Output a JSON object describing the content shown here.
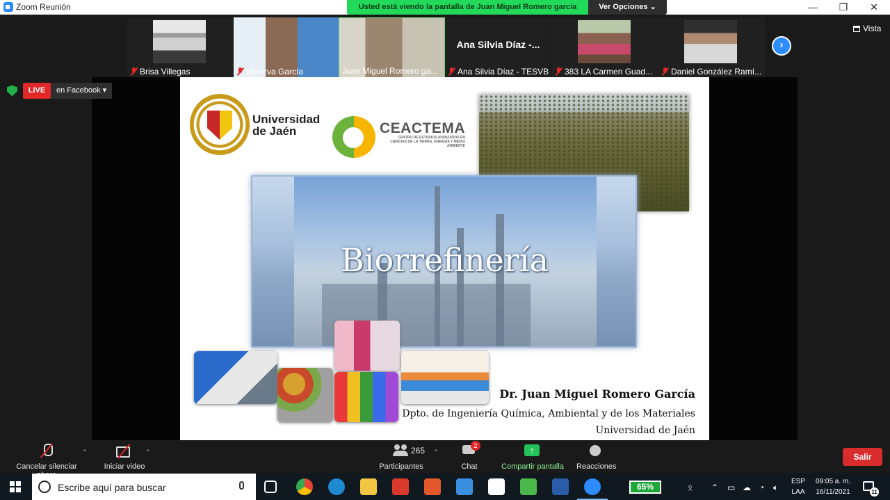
{
  "window": {
    "title": "Zoom Reunión",
    "controls": [
      "—",
      "❐",
      "✕"
    ]
  },
  "share_banner": {
    "text": "Usted está viendo la pantalla de Juan Miguel Romero garcía",
    "view_options": "Ver Opciones ⌄"
  },
  "gallery": {
    "participants": [
      {
        "name": "Brisa Villegas",
        "muted": true,
        "video": true,
        "colors": [
          "#e8e8e8",
          "#3a3a3a"
        ]
      },
      {
        "name": "Minerva García",
        "muted": true,
        "video": true,
        "colors": [
          "#4a86c8",
          "#222"
        ]
      },
      {
        "name": "Juan Miguel Romero ga...",
        "muted": false,
        "video": true,
        "active": true,
        "colors": [
          "#c8c2b2",
          "#6c5a45"
        ]
      },
      {
        "name": "Ana Silvia Díaz - TESVB",
        "display": "Ana Silvia Díaz -...",
        "muted": true,
        "video": false
      },
      {
        "name": "383 LA Carmen Guad...",
        "muted": true,
        "video": true,
        "colors": [
          "#b8c8a8",
          "#6a4a3a"
        ]
      },
      {
        "name": "Daniel González Ramí...",
        "muted": true,
        "video": true,
        "colors": [
          "#d8d8d8",
          "#303030"
        ]
      }
    ],
    "next_icon": "›",
    "view_label": "Vista"
  },
  "live": {
    "badge": "LIVE",
    "destination": "en Facebook ▾"
  },
  "slide": {
    "university": "Universidad\nde Jaén",
    "center_title": "CEACTEMA",
    "center_subtitle": "CENTRO DE ESTUDIOS AVANZADOS EN CIENCIAS DE LA TIERRA, ENERGÍA Y MEDIO AMBIENTE",
    "title": "Biorrefinería",
    "author": "Dr. Juan Miguel Romero García",
    "department": "Dpto. de Ingeniería Química, Ambiental y de los Materiales",
    "institution": "Universidad de Jaén"
  },
  "toolbar": {
    "mute": "Cancelar silenciar ahora",
    "video": "Iniciar video",
    "participants_count": "265",
    "participants": "Participantes",
    "chat": "Chat",
    "chat_badge": "2",
    "share": "Compartir pantalla",
    "reactions": "Reacciones",
    "leave": "Salir"
  },
  "taskbar": {
    "search_placeholder": "Escribe aquí para buscar",
    "battery": "65%",
    "lang_1": "ESP",
    "lang_2": "LAA",
    "time": "09:05 a. m.",
    "date": "16/11/2021",
    "notifications": "11",
    "apps": [
      {
        "name": "task-view",
        "color": "#ffffff"
      },
      {
        "name": "chrome",
        "color": "#e0a020"
      },
      {
        "name": "edge",
        "color": "#1f8ad2"
      },
      {
        "name": "file-explorer",
        "color": "#f4c542"
      },
      {
        "name": "app-red",
        "color": "#d93a2b"
      },
      {
        "name": "powerpoint-like",
        "color": "#e0582b"
      },
      {
        "name": "mail",
        "color": "#3b8fe0"
      },
      {
        "name": "store",
        "color": "#ffffff"
      },
      {
        "name": "green-app",
        "color": "#4cb84c"
      },
      {
        "name": "word",
        "color": "#2b5caa"
      },
      {
        "name": "zoom",
        "color": "#2d8cff",
        "active": true
      }
    ]
  }
}
